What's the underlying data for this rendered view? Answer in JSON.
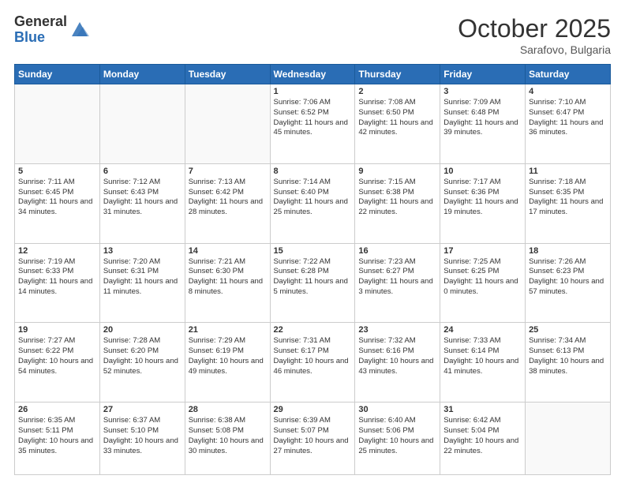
{
  "logo": {
    "general": "General",
    "blue": "Blue"
  },
  "header": {
    "month_year": "October 2025",
    "location": "Sarafovo, Bulgaria"
  },
  "days_of_week": [
    "Sunday",
    "Monday",
    "Tuesday",
    "Wednesday",
    "Thursday",
    "Friday",
    "Saturday"
  ],
  "weeks": [
    [
      {
        "day": "",
        "info": ""
      },
      {
        "day": "",
        "info": ""
      },
      {
        "day": "",
        "info": ""
      },
      {
        "day": "1",
        "info": "Sunrise: 7:06 AM\nSunset: 6:52 PM\nDaylight: 11 hours and 45 minutes."
      },
      {
        "day": "2",
        "info": "Sunrise: 7:08 AM\nSunset: 6:50 PM\nDaylight: 11 hours and 42 minutes."
      },
      {
        "day": "3",
        "info": "Sunrise: 7:09 AM\nSunset: 6:48 PM\nDaylight: 11 hours and 39 minutes."
      },
      {
        "day": "4",
        "info": "Sunrise: 7:10 AM\nSunset: 6:47 PM\nDaylight: 11 hours and 36 minutes."
      }
    ],
    [
      {
        "day": "5",
        "info": "Sunrise: 7:11 AM\nSunset: 6:45 PM\nDaylight: 11 hours and 34 minutes."
      },
      {
        "day": "6",
        "info": "Sunrise: 7:12 AM\nSunset: 6:43 PM\nDaylight: 11 hours and 31 minutes."
      },
      {
        "day": "7",
        "info": "Sunrise: 7:13 AM\nSunset: 6:42 PM\nDaylight: 11 hours and 28 minutes."
      },
      {
        "day": "8",
        "info": "Sunrise: 7:14 AM\nSunset: 6:40 PM\nDaylight: 11 hours and 25 minutes."
      },
      {
        "day": "9",
        "info": "Sunrise: 7:15 AM\nSunset: 6:38 PM\nDaylight: 11 hours and 22 minutes."
      },
      {
        "day": "10",
        "info": "Sunrise: 7:17 AM\nSunset: 6:36 PM\nDaylight: 11 hours and 19 minutes."
      },
      {
        "day": "11",
        "info": "Sunrise: 7:18 AM\nSunset: 6:35 PM\nDaylight: 11 hours and 17 minutes."
      }
    ],
    [
      {
        "day": "12",
        "info": "Sunrise: 7:19 AM\nSunset: 6:33 PM\nDaylight: 11 hours and 14 minutes."
      },
      {
        "day": "13",
        "info": "Sunrise: 7:20 AM\nSunset: 6:31 PM\nDaylight: 11 hours and 11 minutes."
      },
      {
        "day": "14",
        "info": "Sunrise: 7:21 AM\nSunset: 6:30 PM\nDaylight: 11 hours and 8 minutes."
      },
      {
        "day": "15",
        "info": "Sunrise: 7:22 AM\nSunset: 6:28 PM\nDaylight: 11 hours and 5 minutes."
      },
      {
        "day": "16",
        "info": "Sunrise: 7:23 AM\nSunset: 6:27 PM\nDaylight: 11 hours and 3 minutes."
      },
      {
        "day": "17",
        "info": "Sunrise: 7:25 AM\nSunset: 6:25 PM\nDaylight: 11 hours and 0 minutes."
      },
      {
        "day": "18",
        "info": "Sunrise: 7:26 AM\nSunset: 6:23 PM\nDaylight: 10 hours and 57 minutes."
      }
    ],
    [
      {
        "day": "19",
        "info": "Sunrise: 7:27 AM\nSunset: 6:22 PM\nDaylight: 10 hours and 54 minutes."
      },
      {
        "day": "20",
        "info": "Sunrise: 7:28 AM\nSunset: 6:20 PM\nDaylight: 10 hours and 52 minutes."
      },
      {
        "day": "21",
        "info": "Sunrise: 7:29 AM\nSunset: 6:19 PM\nDaylight: 10 hours and 49 minutes."
      },
      {
        "day": "22",
        "info": "Sunrise: 7:31 AM\nSunset: 6:17 PM\nDaylight: 10 hours and 46 minutes."
      },
      {
        "day": "23",
        "info": "Sunrise: 7:32 AM\nSunset: 6:16 PM\nDaylight: 10 hours and 43 minutes."
      },
      {
        "day": "24",
        "info": "Sunrise: 7:33 AM\nSunset: 6:14 PM\nDaylight: 10 hours and 41 minutes."
      },
      {
        "day": "25",
        "info": "Sunrise: 7:34 AM\nSunset: 6:13 PM\nDaylight: 10 hours and 38 minutes."
      }
    ],
    [
      {
        "day": "26",
        "info": "Sunrise: 6:35 AM\nSunset: 5:11 PM\nDaylight: 10 hours and 35 minutes."
      },
      {
        "day": "27",
        "info": "Sunrise: 6:37 AM\nSunset: 5:10 PM\nDaylight: 10 hours and 33 minutes."
      },
      {
        "day": "28",
        "info": "Sunrise: 6:38 AM\nSunset: 5:08 PM\nDaylight: 10 hours and 30 minutes."
      },
      {
        "day": "29",
        "info": "Sunrise: 6:39 AM\nSunset: 5:07 PM\nDaylight: 10 hours and 27 minutes."
      },
      {
        "day": "30",
        "info": "Sunrise: 6:40 AM\nSunset: 5:06 PM\nDaylight: 10 hours and 25 minutes."
      },
      {
        "day": "31",
        "info": "Sunrise: 6:42 AM\nSunset: 5:04 PM\nDaylight: 10 hours and 22 minutes."
      },
      {
        "day": "",
        "info": ""
      }
    ]
  ]
}
